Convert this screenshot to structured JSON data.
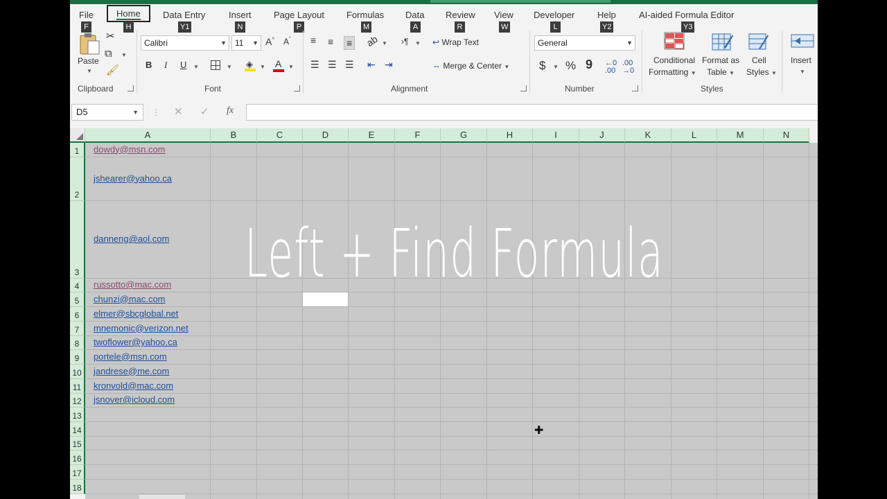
{
  "tabs": [
    {
      "label": "File",
      "key": "F"
    },
    {
      "label": "Home",
      "key": "H",
      "active": true
    },
    {
      "label": "Data Entry",
      "key": "Y1"
    },
    {
      "label": "Insert",
      "key": "N"
    },
    {
      "label": "Page Layout",
      "key": "P"
    },
    {
      "label": "Formulas",
      "key": "M"
    },
    {
      "label": "Data",
      "key": "A"
    },
    {
      "label": "Review",
      "key": "R"
    },
    {
      "label": "View",
      "key": "W"
    },
    {
      "label": "Developer",
      "key": "L"
    },
    {
      "label": "Help",
      "key": "Y2"
    },
    {
      "label": "AI-aided Formula Editor",
      "key": "Y3"
    }
  ],
  "ribbon": {
    "clipboard": {
      "paste_label": "Paste",
      "group_label": "Clipboard"
    },
    "font": {
      "font_name": "Calibri",
      "font_size": "11",
      "group_label": "Font",
      "bold": "B",
      "italic": "I",
      "underline": "U"
    },
    "alignment": {
      "wrap_text": "Wrap Text",
      "merge_center": "Merge & Center",
      "group_label": "Alignment"
    },
    "number": {
      "format": "General",
      "group_label": "Number",
      "currency": "$",
      "percent": "%",
      "comma": "9"
    },
    "styles": {
      "conditional": [
        "Conditional",
        "Formatting"
      ],
      "format_table": [
        "Format as",
        "Table"
      ],
      "cell_styles": [
        "Cell",
        "Styles"
      ],
      "group_label": "Styles"
    },
    "cells": {
      "insert": "Insert"
    }
  },
  "formula_bar": {
    "name_box": "D5",
    "formula": ""
  },
  "columns": [
    "A",
    "B",
    "C",
    "D",
    "E",
    "F",
    "G",
    "H",
    "I",
    "J",
    "K",
    "L",
    "M",
    "N"
  ],
  "rows": [
    "1",
    "2",
    "3",
    "4",
    "5",
    "6",
    "7",
    "8",
    "9",
    "10",
    "11",
    "12",
    "13",
    "14",
    "15",
    "16",
    "17",
    "18"
  ],
  "emails": [
    {
      "text": "dowdy@msn.com",
      "visited": true
    },
    {
      "text": "jshearer@yahoo.ca",
      "visited": false
    },
    {
      "text": "danneng@aol.com",
      "visited": false
    },
    {
      "text": "russotto@mac.com",
      "visited": true
    },
    {
      "text": "chunzi@mac.com",
      "visited": false
    },
    {
      "text": "elmer@sbcglobal.net",
      "visited": false
    },
    {
      "text": "mnemonic@verizon.net",
      "visited": false
    },
    {
      "text": "twoflower@yahoo.ca",
      "visited": false
    },
    {
      "text": "portele@msn.com",
      "visited": false
    },
    {
      "text": "jandrese@me.com",
      "visited": false
    },
    {
      "text": "kronvold@mac.com",
      "visited": false
    },
    {
      "text": "jsnover@icloud.com",
      "visited": false
    }
  ],
  "overlay_title": "Left + Find Formula",
  "colors": {
    "excel_green": "#1e6e42",
    "header_green": "#d4ecd9",
    "link": "#1f4e99",
    "visited": "#8a4a6a"
  }
}
